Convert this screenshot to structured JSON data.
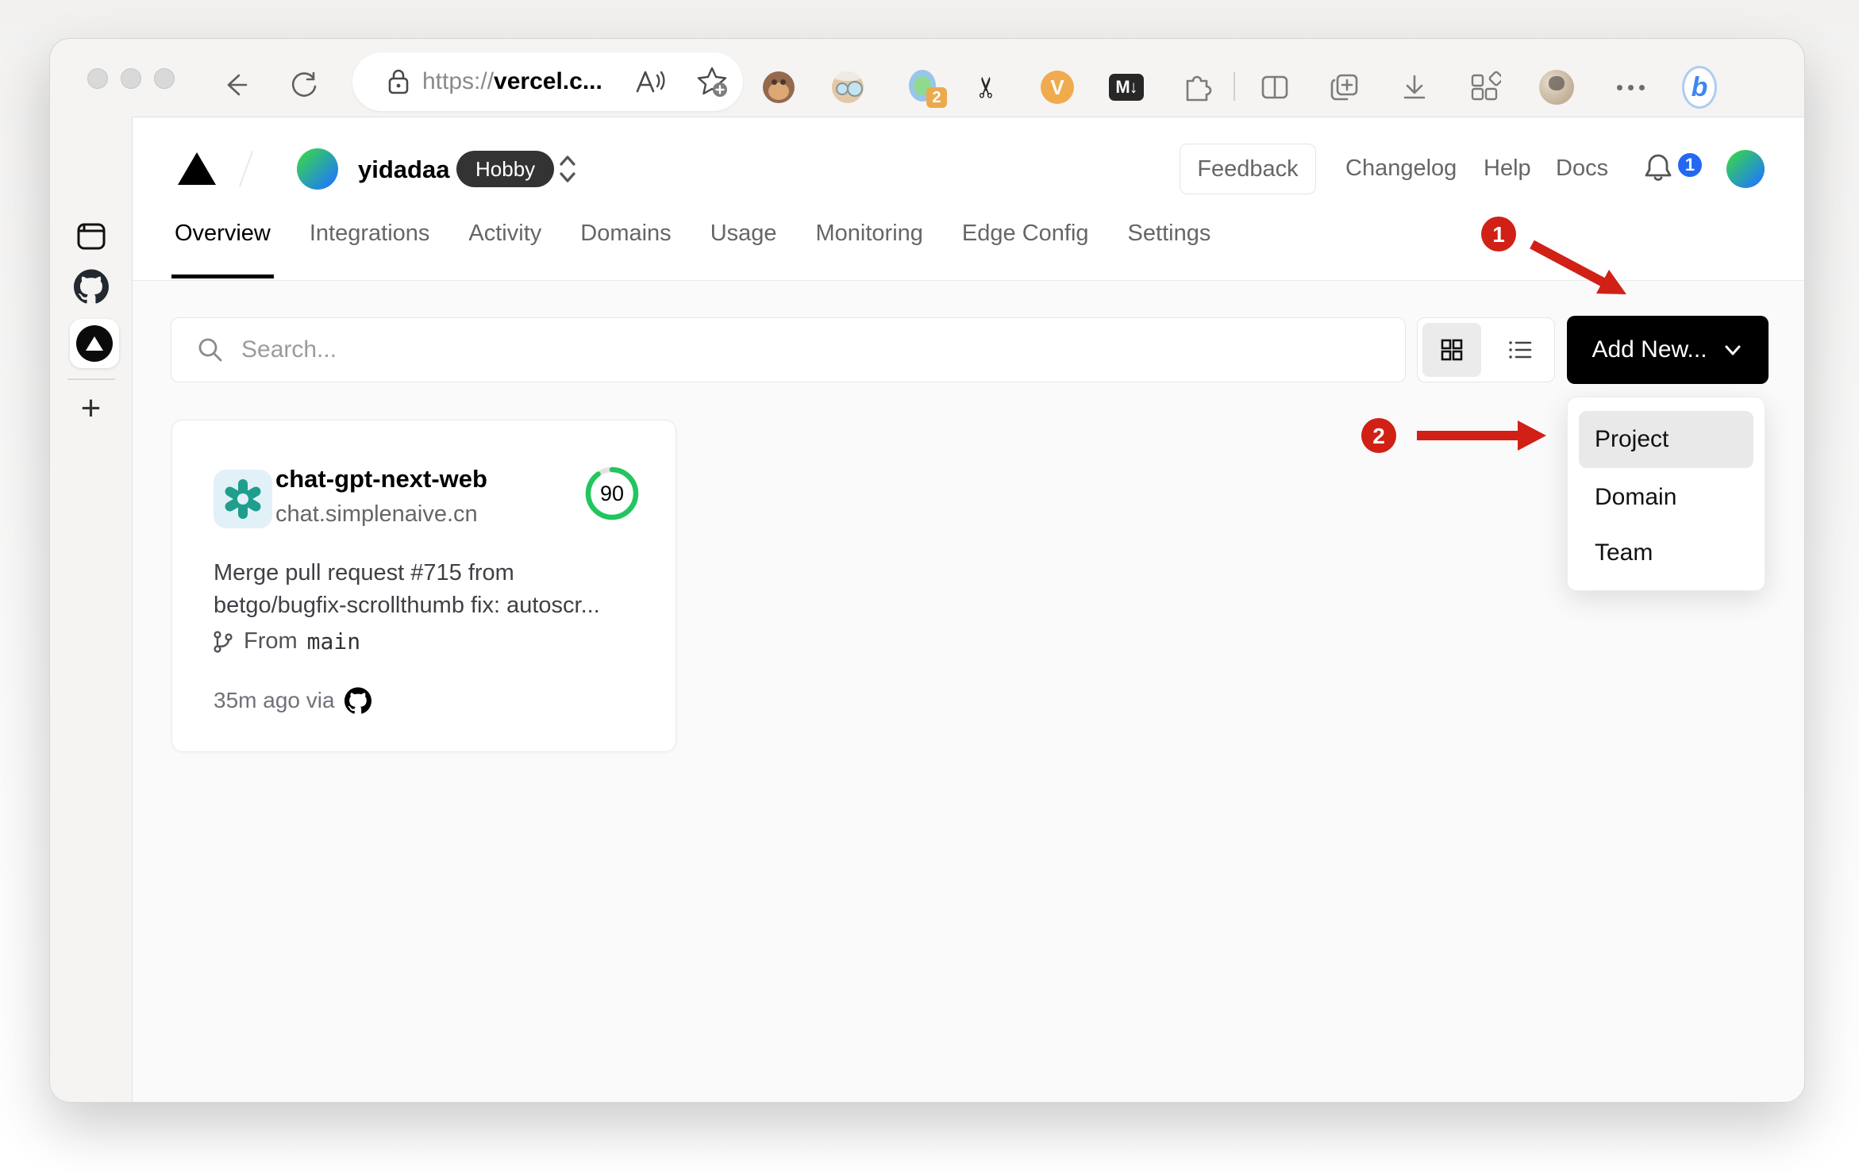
{
  "browser": {
    "url": {
      "scheme": "https://",
      "host": "vercel.c..."
    },
    "extensions": {
      "badge_count": "2",
      "scissors_glyph": "✂",
      "v_label": "V",
      "markdown_label": "M↓",
      "bing_label": "b"
    }
  },
  "vercel": {
    "header": {
      "team_name": "yidadaa",
      "plan_badge": "Hobby",
      "feedback_label": "Feedback",
      "links": [
        "Changelog",
        "Help",
        "Docs"
      ],
      "notification_count": "1"
    },
    "tabs": [
      {
        "label": "Overview"
      },
      {
        "label": "Integrations"
      },
      {
        "label": "Activity"
      },
      {
        "label": "Domains"
      },
      {
        "label": "Usage"
      },
      {
        "label": "Monitoring"
      },
      {
        "label": "Edge Config"
      },
      {
        "label": "Settings"
      }
    ],
    "toolbar": {
      "search_placeholder": "Search...",
      "add_new_label": "Add New..."
    },
    "dropdown": {
      "items": [
        "Project",
        "Domain",
        "Team"
      ]
    },
    "project_card": {
      "name": "chat-gpt-next-web",
      "domain": "chat.simplenaive.cn",
      "score": "90",
      "commit_line1": "Merge pull request #715 from",
      "commit_line2": "betgo/bugfix-scrollthumb fix: autoscr...",
      "branch_prefix": "From",
      "branch_name": "main",
      "updated": "35m ago via"
    },
    "colors": {
      "accent_black": "#000000",
      "score_green": "#22c55e",
      "openai_teal": "#1f9e8e",
      "annotation_red": "#d12015",
      "badge_blue": "#2468f2"
    }
  },
  "annotations": {
    "step_1": "1",
    "step_2": "2"
  }
}
